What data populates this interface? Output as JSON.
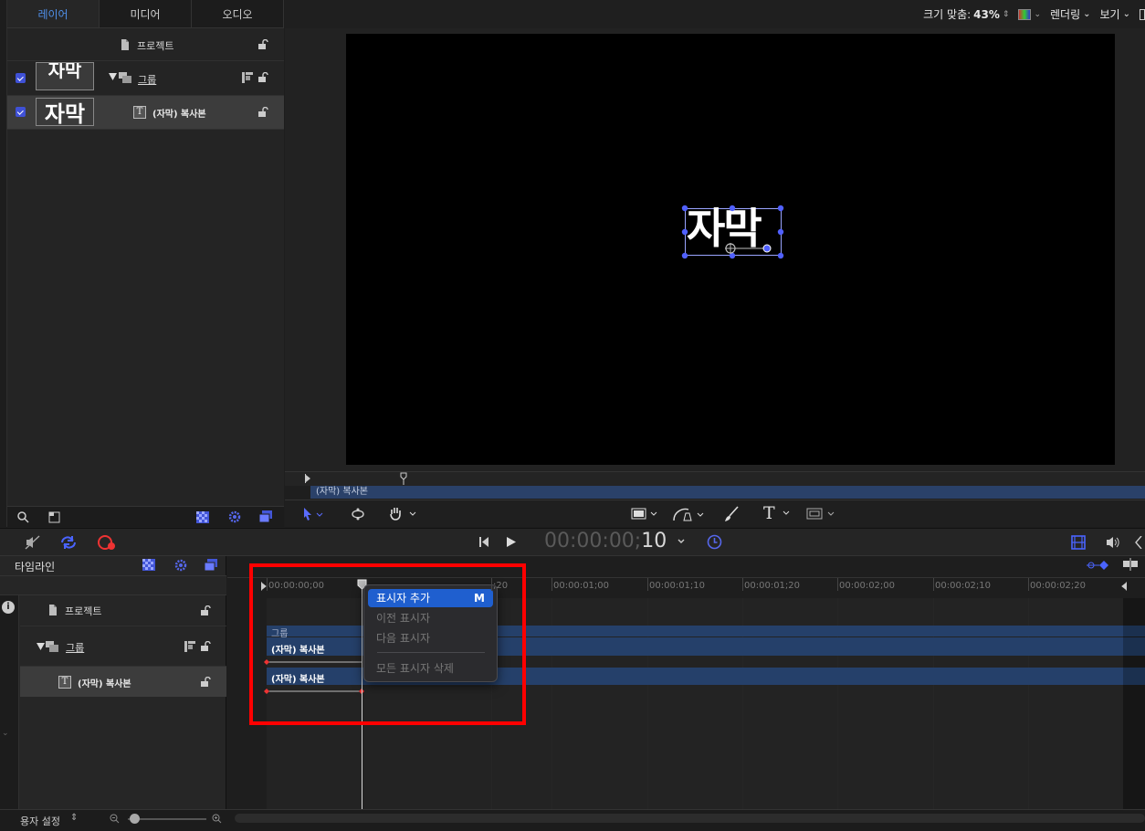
{
  "layers_panel": {
    "tabs": [
      "레이어",
      "미디어",
      "오디오"
    ],
    "active_tab": "레이어",
    "rows": [
      {
        "label": "프로젝트",
        "icon": "document-icon"
      },
      {
        "label": "그룹",
        "thumb_text": "자막",
        "icon": "group-icon",
        "checked": true
      },
      {
        "label": "(자막) 복사본",
        "thumb_text": "자막",
        "icon": "text-layer-icon",
        "checked": true,
        "selected": true
      }
    ]
  },
  "viewer": {
    "fit_label": "크기 맞춤:",
    "zoom": "43%",
    "render_label": "렌더링",
    "view_label": "보기",
    "canvas_text": "자막",
    "mini_clip_label": "(자막) 복사본"
  },
  "transport": {
    "timecode_main": "00:00:00;",
    "timecode_frames": "10"
  },
  "timeline": {
    "title": "타임라인",
    "rows": [
      {
        "label": "프로젝트",
        "icon": "document-icon"
      },
      {
        "label": "그룹",
        "icon": "group-icon"
      },
      {
        "label": "(자막) 복사본",
        "icon": "text-layer-icon"
      }
    ],
    "ruler_labels": [
      "00:00:00;00",
      ";20",
      "00:00:01;00",
      "00:00:01;10",
      "00:00:01;20",
      "00:00:02;00",
      "00:00:02;10",
      "00:00:02;20"
    ],
    "group_label": "그룹",
    "track1_label": "(자막) 복사본",
    "track2_label": "(자막) 복사본",
    "bottom_label": "용자 설정"
  },
  "context_menu": {
    "items": [
      {
        "label": "표시자 추가",
        "shortcut": "M",
        "highlighted": true
      },
      {
        "label": "이전 표시자",
        "enabled": false
      },
      {
        "label": "다음 표시자",
        "enabled": false
      },
      {
        "label": "모든 표시자 삭제",
        "enabled": false
      }
    ]
  },
  "colors": {
    "accent_blue": "#4f8fe8",
    "track_blue": "#25406a",
    "menu_highlight": "#1f5fcf",
    "annotation_red": "#ff0000"
  }
}
